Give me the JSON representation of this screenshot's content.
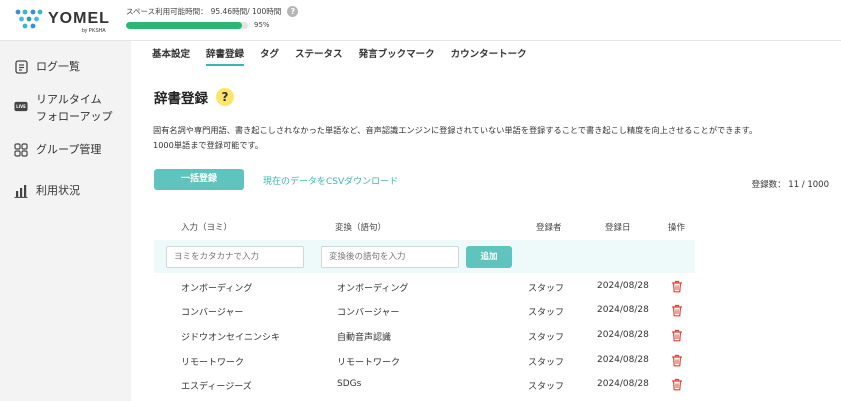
{
  "brand": {
    "name": "YOMEL",
    "byline": "by PKSHA"
  },
  "usage": {
    "label": "スペース利用可能時間：",
    "value": "95.46時間/ 100時間",
    "percent_text": "95%",
    "percent": 95,
    "help": "?"
  },
  "sidebar": {
    "items": [
      {
        "label": "ログ一覧",
        "icon": "document-list-icon"
      },
      {
        "label": "リアルタイム\nフォローアップ",
        "line1": "リアルタイム",
        "line2": "フォローアップ",
        "icon": "live-icon",
        "icon_text": "LIVE"
      },
      {
        "label": "グループ管理",
        "icon": "group-grid-icon"
      },
      {
        "label": "利用状況",
        "icon": "bar-chart-icon"
      }
    ]
  },
  "tabs": [
    {
      "label": "基本設定",
      "active": false
    },
    {
      "label": "辞書登録",
      "active": true
    },
    {
      "label": "タグ",
      "active": false
    },
    {
      "label": "ステータス",
      "active": false
    },
    {
      "label": "発言ブックマーク",
      "active": false
    },
    {
      "label": "カウンタートーク",
      "active": false
    }
  ],
  "page": {
    "title": "辞書登録",
    "help": "?",
    "description_line1": "固有名詞や専門用語、書き起こしされなかった単語など、音声認識エンジンに登録されていない単語を登録することで書き起こし精度を向上させることができます。",
    "description_line2": "1000単語まで登録可能です。",
    "bulk_button": "一括登録",
    "csv_link": "現在のデータをCSVダウンロード",
    "count_text": "登録数： 11 / 1000"
  },
  "table": {
    "headers": [
      "入力（ヨミ）",
      "変換（語句）",
      "登録者",
      "登録日",
      "操作"
    ],
    "input": {
      "yomi_placeholder": "ヨミをカタカナで入力",
      "phrase_placeholder": "変換後の語句を入力",
      "add_button": "追加"
    },
    "rows": [
      {
        "yomi": "オンボーディング",
        "phrase": "オンボーディング",
        "user": "スタッフ",
        "date": "2024/08/28"
      },
      {
        "yomi": "コンバージャー",
        "phrase": "コンバージャー",
        "user": "スタッフ",
        "date": "2024/08/28"
      },
      {
        "yomi": "ジドウオンセイニンシキ",
        "phrase": "自動音声認識",
        "user": "スタッフ",
        "date": "2024/08/28"
      },
      {
        "yomi": "リモートワーク",
        "phrase": "リモートワーク",
        "user": "スタッフ",
        "date": "2024/08/28"
      },
      {
        "yomi": "エスディージーズ",
        "phrase": "SDGs",
        "user": "スタッフ",
        "date": "2024/08/28"
      }
    ]
  },
  "colors": {
    "accent": "#5ec4bd",
    "link": "#3bb8ad",
    "progress": "#2db673",
    "delete": "#e0453a",
    "sidebar_bg": "#f3f3f3",
    "highlight_row": "#eef9f9"
  }
}
